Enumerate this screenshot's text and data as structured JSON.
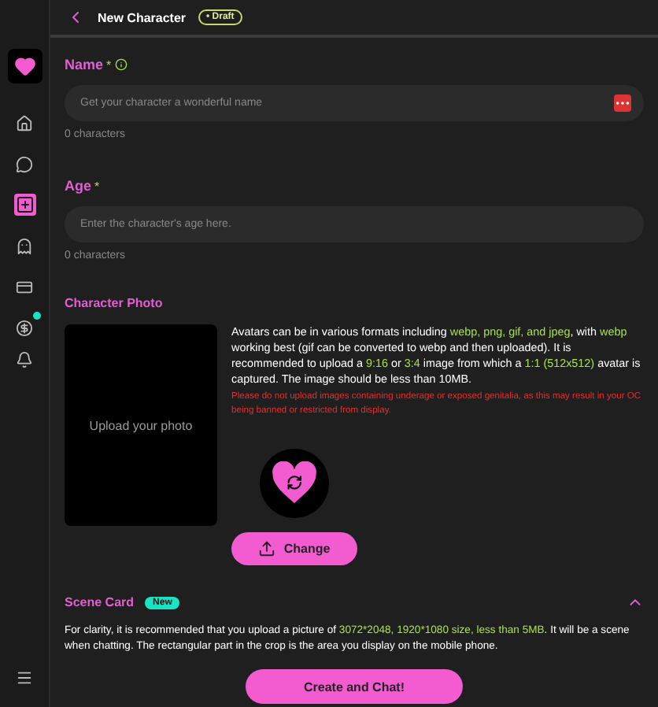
{
  "header": {
    "title": "New Character",
    "badge": "• Draft"
  },
  "sidebar": {
    "items": [
      {
        "kind": "home",
        "selected": false
      },
      {
        "kind": "chat",
        "selected": false
      },
      {
        "kind": "create",
        "selected": true
      },
      {
        "kind": "ghost",
        "selected": false
      },
      {
        "kind": "card",
        "selected": false
      },
      {
        "kind": "coin",
        "selected": false,
        "dot": true
      }
    ]
  },
  "name_field": {
    "label": "Name",
    "required": "*",
    "placeholder": "Get your character a wonderful name",
    "counter": "0 characters"
  },
  "age_field": {
    "label": "Age",
    "required": "*",
    "placeholder": "Enter the character's age here.",
    "counter": "0 characters"
  },
  "photo": {
    "title": "Character Photo",
    "upload_label": "Upload your photo",
    "info": [
      {
        "text": "Avatars can be in various formats including ",
        "highlight": false
      },
      {
        "text": "webp, png, gif, and jpeg",
        "highlight": true
      },
      {
        "text": ", with ",
        "highlight": false
      },
      {
        "text": "webp",
        "highlight": true
      },
      {
        "text": " working best (gif can be converted to webp and then uploaded). It is recommended to upload a ",
        "highlight": false
      },
      {
        "text": "9:16",
        "highlight": true
      },
      {
        "text": " or ",
        "highlight": false
      },
      {
        "text": "3:4",
        "highlight": true
      },
      {
        "text": " image from which a ",
        "highlight": false
      },
      {
        "text": "1:1 (512x512)",
        "highlight": true
      },
      {
        "text": " avatar is captured. The image should be less than 10MB.",
        "highlight": false
      }
    ],
    "warning": "Please do not upload images containing underage or exposed genitalia, as this may result in your OC being banned or restricted from display.",
    "change_button": "Change"
  },
  "scene_card": {
    "title": "Scene Card",
    "badge": "New",
    "expanded": true,
    "info": [
      {
        "text": "For clarity, it is recommended that you upload a picture of ",
        "highlight": false
      },
      {
        "text": "3072*2048, 1920*1080 size, less than 5MB",
        "highlight": true
      },
      {
        "text": ". It will be a scene when chatting. The rectangular part in the crop is the area you display on the mobile phone.",
        "highlight": false
      }
    ]
  },
  "submit_button": "Create and Chat!"
}
